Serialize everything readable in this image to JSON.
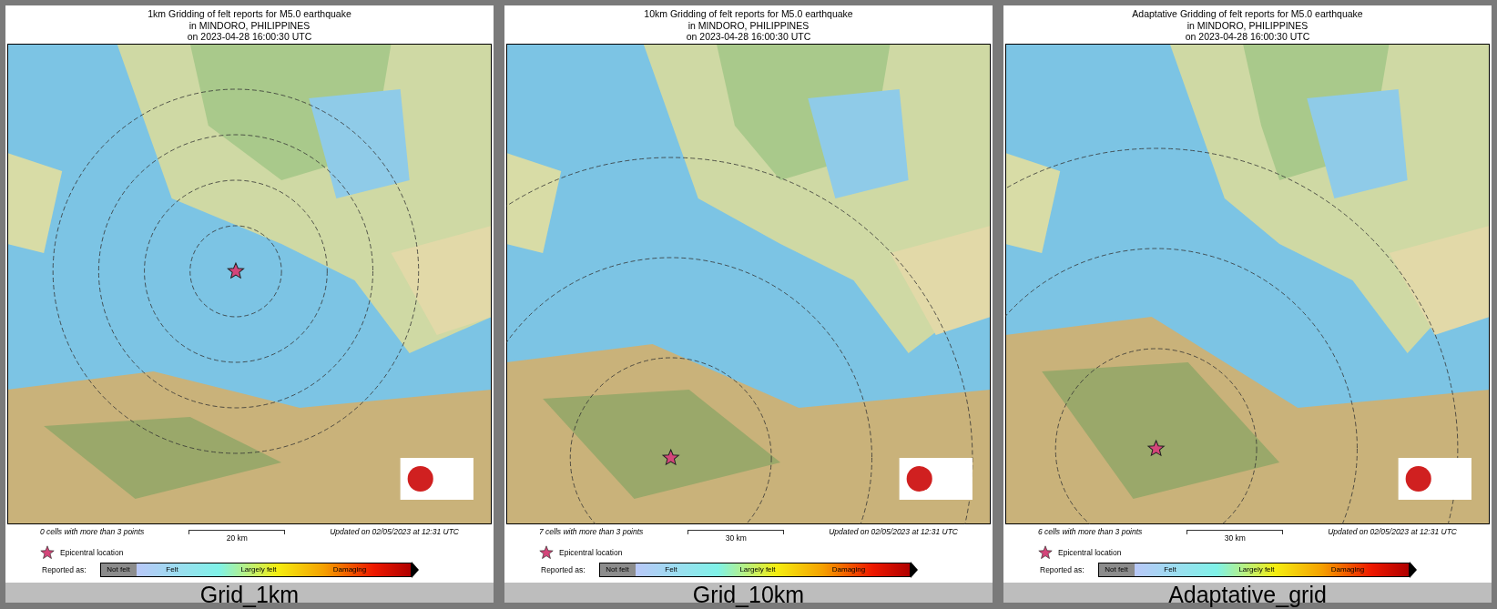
{
  "panels": [
    {
      "title_lines": [
        "1km Gridding of felt reports for M5.0 earthquake",
        "in MINDORO, PHILIPPINES",
        "on  2023-04-28 16:00:30 UTC"
      ],
      "cells_note": "0 cells with more than 3 points",
      "scale": "20 km",
      "updated": "Updated on 02/05/2023 at 12:31 UTC",
      "epicenter_label": "Epicentral location",
      "reported_as": "Reported as:",
      "classes": [
        "Not felt",
        "Felt",
        "Largely felt",
        "Damaging"
      ],
      "caption": "Grid_1km"
    },
    {
      "title_lines": [
        "10km Gridding of felt reports for M5.0 earthquake",
        "in MINDORO, PHILIPPINES",
        "on  2023-04-28 16:00:30 UTC"
      ],
      "cells_note": "7 cells with more than 3 points",
      "scale": "30 km",
      "updated": "Updated on 02/05/2023 at 12:31 UTC",
      "epicenter_label": "Epicentral location",
      "reported_as": "Reported as:",
      "classes": [
        "Not felt",
        "Felt",
        "Largely felt",
        "Damaging"
      ],
      "caption": "Grid_10km"
    },
    {
      "title_lines": [
        "Adaptative Gridding of felt reports for M5.0 earthquake",
        "in MINDORO, PHILIPPINES",
        "on  2023-04-28 16:00:30 UTC"
      ],
      "cells_note": "6 cells with more than 3 points",
      "scale": "30 km",
      "updated": "Updated on 02/05/2023 at 12:31 UTC",
      "epicenter_label": "Epicentral location",
      "reported_as": "Reported as:",
      "classes": [
        "Not felt",
        "Felt",
        "Largely felt",
        "Damaging"
      ],
      "caption": "Adaptative_grid"
    }
  ]
}
